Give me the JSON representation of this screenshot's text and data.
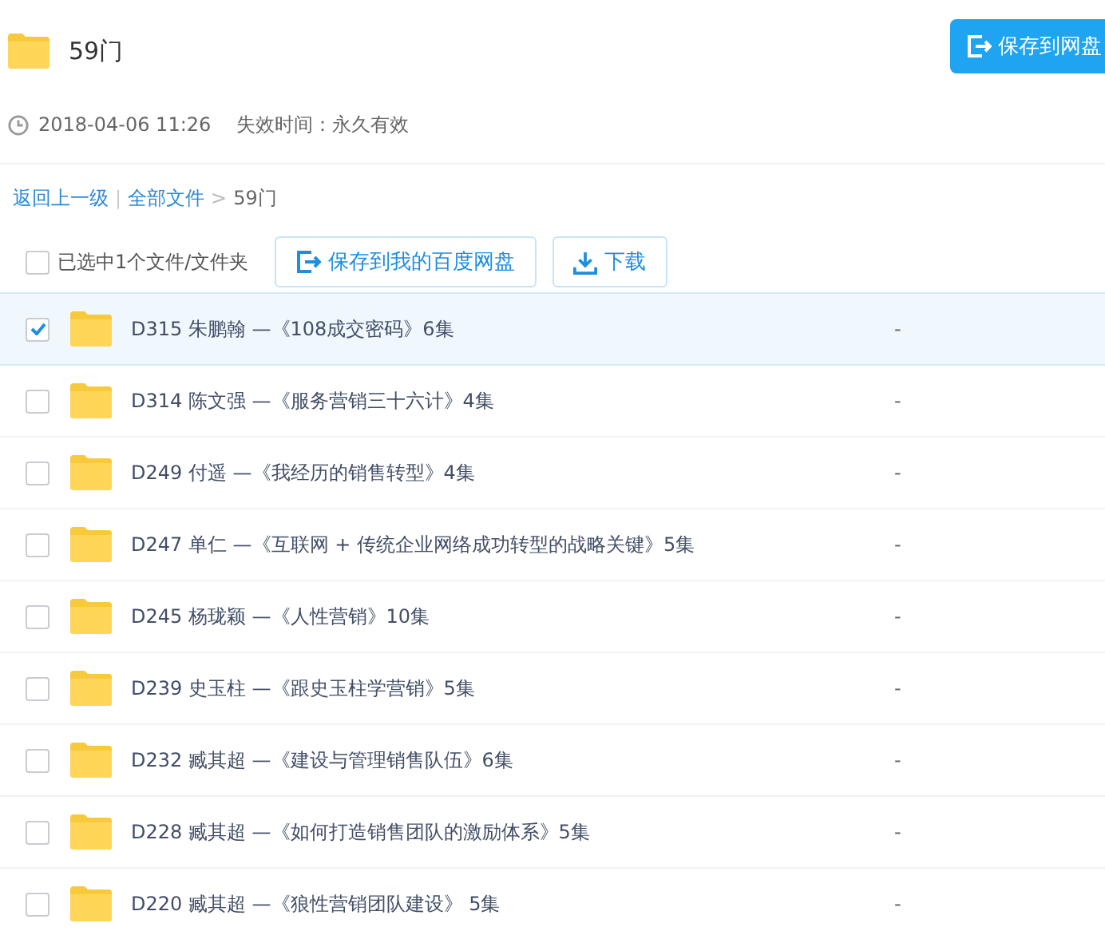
{
  "header": {
    "title": "59门",
    "save_button": "保存到网盘"
  },
  "meta": {
    "date": "2018-04-06 11:26",
    "expiry": "失效时间：永久有效"
  },
  "breadcrumb": {
    "back": "返回上一级",
    "separator": "|",
    "root": "全部文件",
    "arrow": ">",
    "current": "59门"
  },
  "toolbar": {
    "select_all": {
      "label": "已选中1个文件/文件夹",
      "checked": false
    },
    "save_button": "保存到我的百度网盘",
    "download_button": "下载"
  },
  "files": [
    {
      "name": "D315 朱鹏翰 —《108成交密码》6集",
      "size": "-",
      "selected": true
    },
    {
      "name": "D314 陈文强 —《服务营销三十六计》4集",
      "size": "-",
      "selected": false
    },
    {
      "name": "D249 付遥 —《我经历的销售转型》4集",
      "size": "-",
      "selected": false
    },
    {
      "name": "D247 单仁 —《互联网 + 传统企业网络成功转型的战略关键》5集",
      "size": "-",
      "selected": false
    },
    {
      "name": "D245 杨珑颖 —《人性营销》10集",
      "size": "-",
      "selected": false
    },
    {
      "name": "D239 史玉柱 —《跟史玉柱学营销》5集",
      "size": "-",
      "selected": false
    },
    {
      "name": "D232 臧其超 —《建设与管理销售队伍》6集",
      "size": "-",
      "selected": false
    },
    {
      "name": "D228 臧其超 —《如何打造销售团队的激励体系》5集",
      "size": "-",
      "selected": false
    },
    {
      "name": "D220 臧其超 —《狼性营销团队建设》 5集",
      "size": "-",
      "selected": false
    }
  ]
}
